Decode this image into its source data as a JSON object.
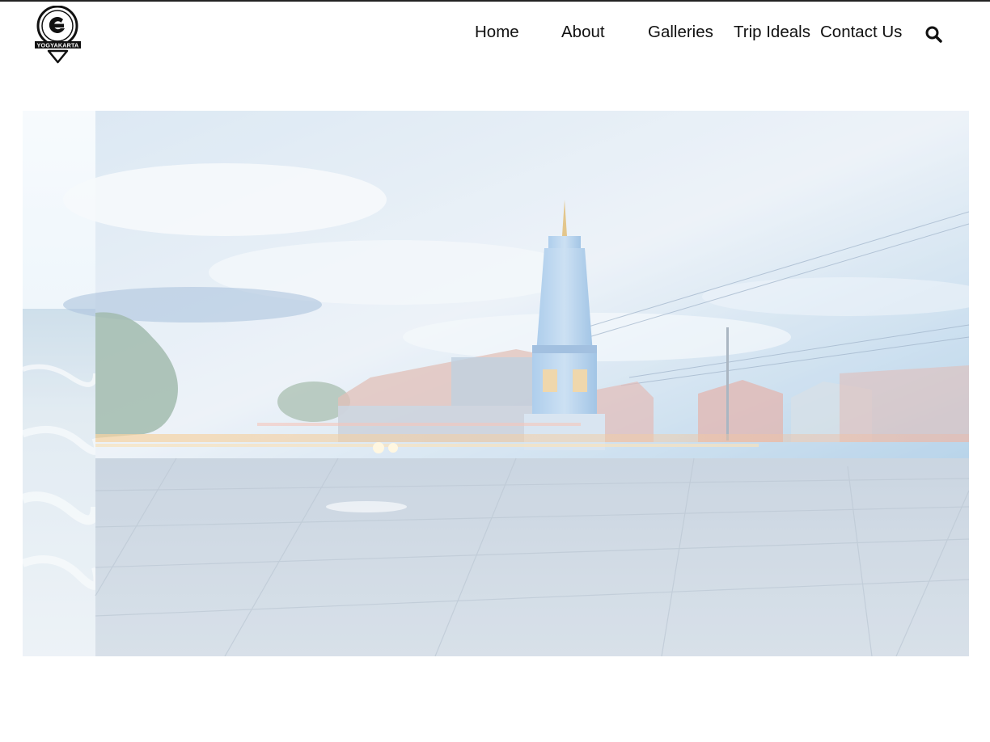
{
  "logo": {
    "text": "YOGYAKARTA",
    "icon": "location-pin-e-logo-icon"
  },
  "nav": {
    "items": [
      {
        "label": "Home"
      },
      {
        "label": "About"
      },
      {
        "label": "Galleries"
      },
      {
        "label": "Trip Ideals"
      },
      {
        "label": "Contact Us"
      }
    ],
    "search_icon": "search-icon"
  },
  "hero": {
    "image": "tugu-yogyakarta-monument-dusk-photo",
    "side_image": "ocean-waves-photo"
  },
  "colors": {
    "nav_text": "#111111",
    "top_border": "#222222",
    "background": "#ffffff"
  }
}
